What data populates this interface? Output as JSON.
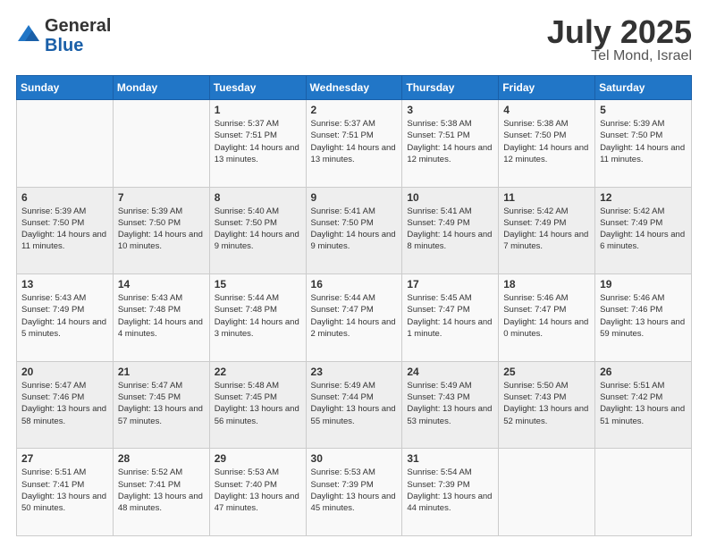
{
  "header": {
    "logo_general": "General",
    "logo_blue": "Blue",
    "title": "July 2025",
    "location": "Tel Mond, Israel"
  },
  "weekdays": [
    "Sunday",
    "Monday",
    "Tuesday",
    "Wednesday",
    "Thursday",
    "Friday",
    "Saturday"
  ],
  "weeks": [
    [
      {
        "day": "",
        "info": ""
      },
      {
        "day": "",
        "info": ""
      },
      {
        "day": "1",
        "info": "Sunrise: 5:37 AM\nSunset: 7:51 PM\nDaylight: 14 hours and 13 minutes."
      },
      {
        "day": "2",
        "info": "Sunrise: 5:37 AM\nSunset: 7:51 PM\nDaylight: 14 hours and 13 minutes."
      },
      {
        "day": "3",
        "info": "Sunrise: 5:38 AM\nSunset: 7:51 PM\nDaylight: 14 hours and 12 minutes."
      },
      {
        "day": "4",
        "info": "Sunrise: 5:38 AM\nSunset: 7:50 PM\nDaylight: 14 hours and 12 minutes."
      },
      {
        "day": "5",
        "info": "Sunrise: 5:39 AM\nSunset: 7:50 PM\nDaylight: 14 hours and 11 minutes."
      }
    ],
    [
      {
        "day": "6",
        "info": "Sunrise: 5:39 AM\nSunset: 7:50 PM\nDaylight: 14 hours and 11 minutes."
      },
      {
        "day": "7",
        "info": "Sunrise: 5:39 AM\nSunset: 7:50 PM\nDaylight: 14 hours and 10 minutes."
      },
      {
        "day": "8",
        "info": "Sunrise: 5:40 AM\nSunset: 7:50 PM\nDaylight: 14 hours and 9 minutes."
      },
      {
        "day": "9",
        "info": "Sunrise: 5:41 AM\nSunset: 7:50 PM\nDaylight: 14 hours and 9 minutes."
      },
      {
        "day": "10",
        "info": "Sunrise: 5:41 AM\nSunset: 7:49 PM\nDaylight: 14 hours and 8 minutes."
      },
      {
        "day": "11",
        "info": "Sunrise: 5:42 AM\nSunset: 7:49 PM\nDaylight: 14 hours and 7 minutes."
      },
      {
        "day": "12",
        "info": "Sunrise: 5:42 AM\nSunset: 7:49 PM\nDaylight: 14 hours and 6 minutes."
      }
    ],
    [
      {
        "day": "13",
        "info": "Sunrise: 5:43 AM\nSunset: 7:49 PM\nDaylight: 14 hours and 5 minutes."
      },
      {
        "day": "14",
        "info": "Sunrise: 5:43 AM\nSunset: 7:48 PM\nDaylight: 14 hours and 4 minutes."
      },
      {
        "day": "15",
        "info": "Sunrise: 5:44 AM\nSunset: 7:48 PM\nDaylight: 14 hours and 3 minutes."
      },
      {
        "day": "16",
        "info": "Sunrise: 5:44 AM\nSunset: 7:47 PM\nDaylight: 14 hours and 2 minutes."
      },
      {
        "day": "17",
        "info": "Sunrise: 5:45 AM\nSunset: 7:47 PM\nDaylight: 14 hours and 1 minute."
      },
      {
        "day": "18",
        "info": "Sunrise: 5:46 AM\nSunset: 7:47 PM\nDaylight: 14 hours and 0 minutes."
      },
      {
        "day": "19",
        "info": "Sunrise: 5:46 AM\nSunset: 7:46 PM\nDaylight: 13 hours and 59 minutes."
      }
    ],
    [
      {
        "day": "20",
        "info": "Sunrise: 5:47 AM\nSunset: 7:46 PM\nDaylight: 13 hours and 58 minutes."
      },
      {
        "day": "21",
        "info": "Sunrise: 5:47 AM\nSunset: 7:45 PM\nDaylight: 13 hours and 57 minutes."
      },
      {
        "day": "22",
        "info": "Sunrise: 5:48 AM\nSunset: 7:45 PM\nDaylight: 13 hours and 56 minutes."
      },
      {
        "day": "23",
        "info": "Sunrise: 5:49 AM\nSunset: 7:44 PM\nDaylight: 13 hours and 55 minutes."
      },
      {
        "day": "24",
        "info": "Sunrise: 5:49 AM\nSunset: 7:43 PM\nDaylight: 13 hours and 53 minutes."
      },
      {
        "day": "25",
        "info": "Sunrise: 5:50 AM\nSunset: 7:43 PM\nDaylight: 13 hours and 52 minutes."
      },
      {
        "day": "26",
        "info": "Sunrise: 5:51 AM\nSunset: 7:42 PM\nDaylight: 13 hours and 51 minutes."
      }
    ],
    [
      {
        "day": "27",
        "info": "Sunrise: 5:51 AM\nSunset: 7:41 PM\nDaylight: 13 hours and 50 minutes."
      },
      {
        "day": "28",
        "info": "Sunrise: 5:52 AM\nSunset: 7:41 PM\nDaylight: 13 hours and 48 minutes."
      },
      {
        "day": "29",
        "info": "Sunrise: 5:53 AM\nSunset: 7:40 PM\nDaylight: 13 hours and 47 minutes."
      },
      {
        "day": "30",
        "info": "Sunrise: 5:53 AM\nSunset: 7:39 PM\nDaylight: 13 hours and 45 minutes."
      },
      {
        "day": "31",
        "info": "Sunrise: 5:54 AM\nSunset: 7:39 PM\nDaylight: 13 hours and 44 minutes."
      },
      {
        "day": "",
        "info": ""
      },
      {
        "day": "",
        "info": ""
      }
    ]
  ]
}
